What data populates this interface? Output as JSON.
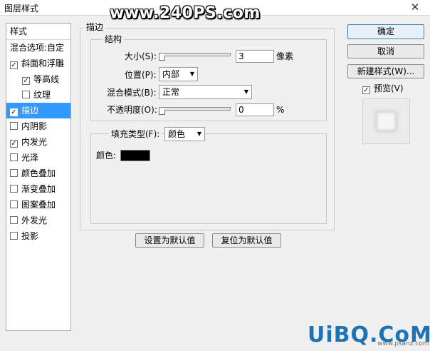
{
  "window": {
    "title": "图层样式",
    "close_glyph": "✕"
  },
  "watermark_top": "www.240PS.com",
  "watermark_bottom": {
    "logo": "UiBQ.CoM",
    "url": "www.psanz.com"
  },
  "style_list": {
    "header": "样式",
    "blend_options": "混合选项:自定",
    "items": [
      {
        "label": "斜面和浮雕",
        "checked": true,
        "indent": false,
        "selected": false
      },
      {
        "label": "等高线",
        "checked": true,
        "indent": true,
        "selected": false
      },
      {
        "label": "纹理",
        "checked": false,
        "indent": true,
        "selected": false
      },
      {
        "label": "描边",
        "checked": true,
        "indent": false,
        "selected": true
      },
      {
        "label": "内阴影",
        "checked": false,
        "indent": false,
        "selected": false
      },
      {
        "label": "内发光",
        "checked": true,
        "indent": false,
        "selected": false
      },
      {
        "label": "光泽",
        "checked": false,
        "indent": false,
        "selected": false
      },
      {
        "label": "颜色叠加",
        "checked": false,
        "indent": false,
        "selected": false
      },
      {
        "label": "渐变叠加",
        "checked": false,
        "indent": false,
        "selected": false
      },
      {
        "label": "图案叠加",
        "checked": false,
        "indent": false,
        "selected": false
      },
      {
        "label": "外发光",
        "checked": false,
        "indent": false,
        "selected": false
      },
      {
        "label": "投影",
        "checked": false,
        "indent": false,
        "selected": false
      }
    ]
  },
  "stroke": {
    "group_title": "描边",
    "structure_title": "结构",
    "size_label": "大小(S):",
    "size_value": "3",
    "size_unit": "像素",
    "size_slider_fraction": 0.0,
    "position_label": "位置(P):",
    "position_value": "内部",
    "blend_mode_label": "混合模式(B):",
    "blend_mode_value": "正常",
    "opacity_label": "不透明度(O):",
    "opacity_value": "0",
    "opacity_unit": "%",
    "opacity_slider_fraction": 0.0,
    "fill_type_label": "填充类型(F):",
    "fill_type_value": "颜色",
    "color_label": "颜色:",
    "color_value": "#000000"
  },
  "bottom_buttons": {
    "set_default": "设置为默认值",
    "reset_default": "复位为默认值"
  },
  "right_panel": {
    "ok": "确定",
    "cancel": "取消",
    "new_style": "新建样式(W)...",
    "preview_label": "预览(V)",
    "preview_checked": true
  },
  "colors": {
    "selection": "#3399ff",
    "swatch": "#000000"
  }
}
